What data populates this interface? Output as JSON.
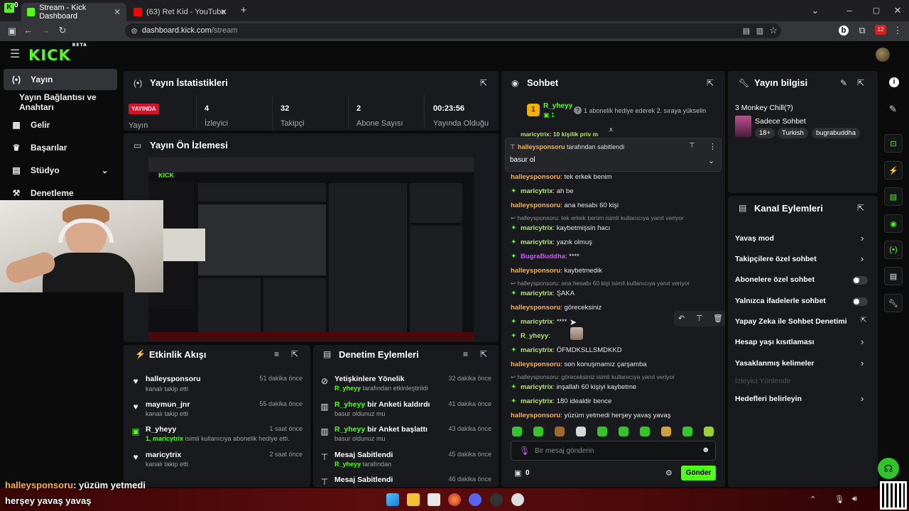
{
  "browser": {
    "tabs": [
      {
        "label": "Stream - Kick Dashboard",
        "active": true
      },
      {
        "label": "(63) Ret Kid - YouTube",
        "active": false
      }
    ],
    "url_host": "dashboard.kick.com",
    "url_path": "/stream",
    "ext_badge": "12",
    "corner_count": "0"
  },
  "kick": {
    "logo": "KICK",
    "beta": "BETA"
  },
  "sidebar": {
    "items": [
      {
        "label": "Yayın",
        "icon": "signal-icon"
      },
      {
        "label": "Yayın Bağlantısı ve Anahtarı",
        "icon": ""
      },
      {
        "label": "Gelir",
        "icon": "chart-icon"
      },
      {
        "label": "Başarılar",
        "icon": "trophy-icon"
      },
      {
        "label": "Stüdyo",
        "icon": "studio-icon"
      },
      {
        "label": "Denetleme",
        "icon": "mod-icon"
      }
    ]
  },
  "stats": {
    "title": "Yayın İstatistikleri",
    "live_badge": "YAYINDA",
    "live_label": "Yayın",
    "items": [
      {
        "value": "4",
        "label": "İzleyici"
      },
      {
        "value": "32",
        "label": "Takipçi"
      },
      {
        "value": "2",
        "label": "Abone Sayısı"
      },
      {
        "value": "00:23:56",
        "label": "Yayında Olduğu Sü"
      }
    ]
  },
  "preview": {
    "title": "Yayın Ön İzlemesi"
  },
  "activity": {
    "title": "Etkinlik Akışı",
    "rows": [
      {
        "user": "halleysponsoru",
        "sub": "kanalı takip etti",
        "time": "51 dakika önce",
        "icon": "heart-icon"
      },
      {
        "user": "maymun_jnr",
        "sub": "kanalı takip etti",
        "time": "55 dakika önce",
        "icon": "heart-icon"
      },
      {
        "user": "R_yheyy",
        "sub_gift_count": "1,",
        "sub_gift_user": "maricytrix",
        "sub": "isimli kullanıcıya abonelik hediye etti.",
        "time": "1 saat önce",
        "icon": "gift-icon"
      },
      {
        "user": "maricytrix",
        "sub": "kanalı takip etti",
        "time": "2 saat önce",
        "icon": "heart-icon"
      }
    ]
  },
  "moderation": {
    "title": "Denetim Eylemleri",
    "rows": [
      {
        "title": "Yetişkinlere Yönelik",
        "user": "R_yheyy",
        "sub": "tarafından etkinleştirildi",
        "time": "32 dakika önce"
      },
      {
        "user": "R_yheyy",
        "title": "bir Anketi kaldırdı",
        "sub": "basur oldunuz mu",
        "time": "41 dakika önce"
      },
      {
        "user": "R_yheyy",
        "title": "bir Anket başlattı",
        "sub": "basur oldunuz mu",
        "time": "43 dakika önce"
      },
      {
        "title": "Mesaj Sabitlendi",
        "user": "R_yheyy",
        "sub": "tarafından",
        "time": "45 dakika önce"
      },
      {
        "title": "Mesaj Sabitlendi",
        "time": "46 dakika önce"
      }
    ]
  },
  "chat": {
    "title": "Sohbet",
    "top_user": "R_yheyy",
    "top_rank": "1",
    "gift_text": "1 abonelik hediye ederek 2. sıraya yükselin",
    "partial_line": "maricytrix: 10 kişilik priv m",
    "pinned_by": "halleysponsoru",
    "pinned_suffix": "tarafından sabitlendi",
    "pinned_text": "basur ol",
    "messages": [
      {
        "user": "halleysponsoru",
        "text": ": tek erkek benim",
        "color": "#ffb13b",
        "badge": false
      },
      {
        "user": "maricytrix",
        "text": ": ah be",
        "color": "#b7e56b",
        "badge": true
      },
      {
        "user": "halleysponsoru",
        "text": ": ana hesabı 60 kişi",
        "color": "#ffb13b",
        "badge": false
      },
      {
        "reply": "halleysponsoru: tek erkek benim isimli kullanıcıya yanıt veriyor"
      },
      {
        "user": "maricytrix",
        "text": ": kaybetmişsin hacı",
        "color": "#b7e56b",
        "badge": true
      },
      {
        "user": "maricytrix",
        "text": ": yazık olmuş",
        "color": "#b7e56b",
        "badge": true
      },
      {
        "user": "BugraBuddha",
        "text": ": ****",
        "color": "#d352ff",
        "badge": true
      },
      {
        "user": "halleysponsoru",
        "text": ": kaybetmedik",
        "color": "#ffb13b",
        "badge": false
      },
      {
        "reply": "halleysponsoru: ana hesabı 60 kişi isimli kullanıcıya yanıt veriyor"
      },
      {
        "user": "maricytrix",
        "text": ": ŞAKA",
        "color": "#b7e56b",
        "badge": true
      },
      {
        "user": "halleysponsoru",
        "text": ": göreceksiniz",
        "color": "#ffb13b",
        "badge": false
      },
      {
        "user": "maricytrix",
        "text": ": ****",
        "color": "#b7e56b",
        "badge": true
      },
      {
        "user": "R_yheyy",
        "text": ":",
        "color": "#b7e56b",
        "badge": true
      },
      {
        "user": "maricytrix",
        "text": ": ÖFMDKSLLSMDKKD",
        "color": "#b7e56b",
        "badge": true
      },
      {
        "user": "halleysponsoru",
        "text": ": son konuşmamız çarşamba",
        "color": "#ffb13b",
        "badge": false
      },
      {
        "reply": "halleysponsoru: göreceksiniz isimli kullanıcıya yanıt veriyor"
      },
      {
        "user": "maricytrix",
        "text": ": inşallah 60 kişiyi kaybetme",
        "color": "#b7e56b",
        "badge": true
      },
      {
        "user": "maricytrix",
        "text": ": 180 idealdir bence",
        "color": "#b7e56b",
        "badge": true
      },
      {
        "user": "halleysponsoru",
        "text": ": yüzüm yetmedi herşey yavaş yavaş",
        "color": "#ffb13b",
        "badge": false
      }
    ],
    "input_placeholder": "Bir mesaj gönderin",
    "points": "0",
    "send_label": "Gönder"
  },
  "stream_info": {
    "title": "Yayın bilgisi",
    "stream_title": "3 Monkey Chill(?)",
    "category": "Sadece Sohbet",
    "tags": [
      "18+",
      "Turkish",
      "bugrabuddha"
    ]
  },
  "channel_actions": {
    "title": "Kanal Eylemleri",
    "items": [
      {
        "label": "Yavaş mod",
        "control": "chevron"
      },
      {
        "label": "Takipçilere özel sohbet",
        "control": "chevron"
      },
      {
        "label": "Abonelere özel sohbet",
        "control": "toggle"
      },
      {
        "label": "Yalnızca ifadelerle sohbet",
        "control": "toggle"
      },
      {
        "label": "Yapay Zeka ile Sohbet Denetimi",
        "control": "external"
      },
      {
        "label": "Hesap yaşı kısıtlaması",
        "control": "chevron"
      },
      {
        "label": "Yasaklanmış kelimeler",
        "control": "chevron"
      },
      {
        "label": "İzleyici Yönlendir",
        "control": "none",
        "disabled": true
      },
      {
        "label": "Hedefleri belirleyin",
        "control": "chevron"
      }
    ]
  },
  "overlay": {
    "user": "halleysponsoru",
    "line1": ": yüzüm yetmedi",
    "line2": "herşey yavaş yavaş"
  },
  "colors": {
    "kick_green": "#53fc18",
    "live_red": "#d3132a",
    "panel_bg": "#191a1d"
  }
}
